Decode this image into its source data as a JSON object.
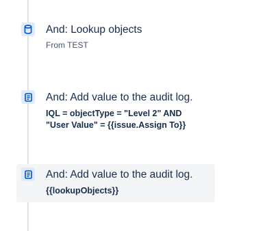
{
  "steps": [
    {
      "icon": "database-icon",
      "title": "And: Lookup objects",
      "detail": "From TEST"
    },
    {
      "icon": "document-icon",
      "title": "And: Add value to the audit log.",
      "detail_line1": "IQL = objectType = \"Level 2\" AND",
      "detail_line2": "\"User Value\" = {{issue.Assign To}}"
    },
    {
      "icon": "document-icon",
      "title": "And: Add value to the audit log.",
      "detail": "{{lookupObjects}}"
    }
  ],
  "colors": {
    "icon_bg": "#deebff",
    "icon_fg": "#0052cc",
    "rail": "#dfe1e6",
    "hover_bg": "#f4f5f7"
  }
}
